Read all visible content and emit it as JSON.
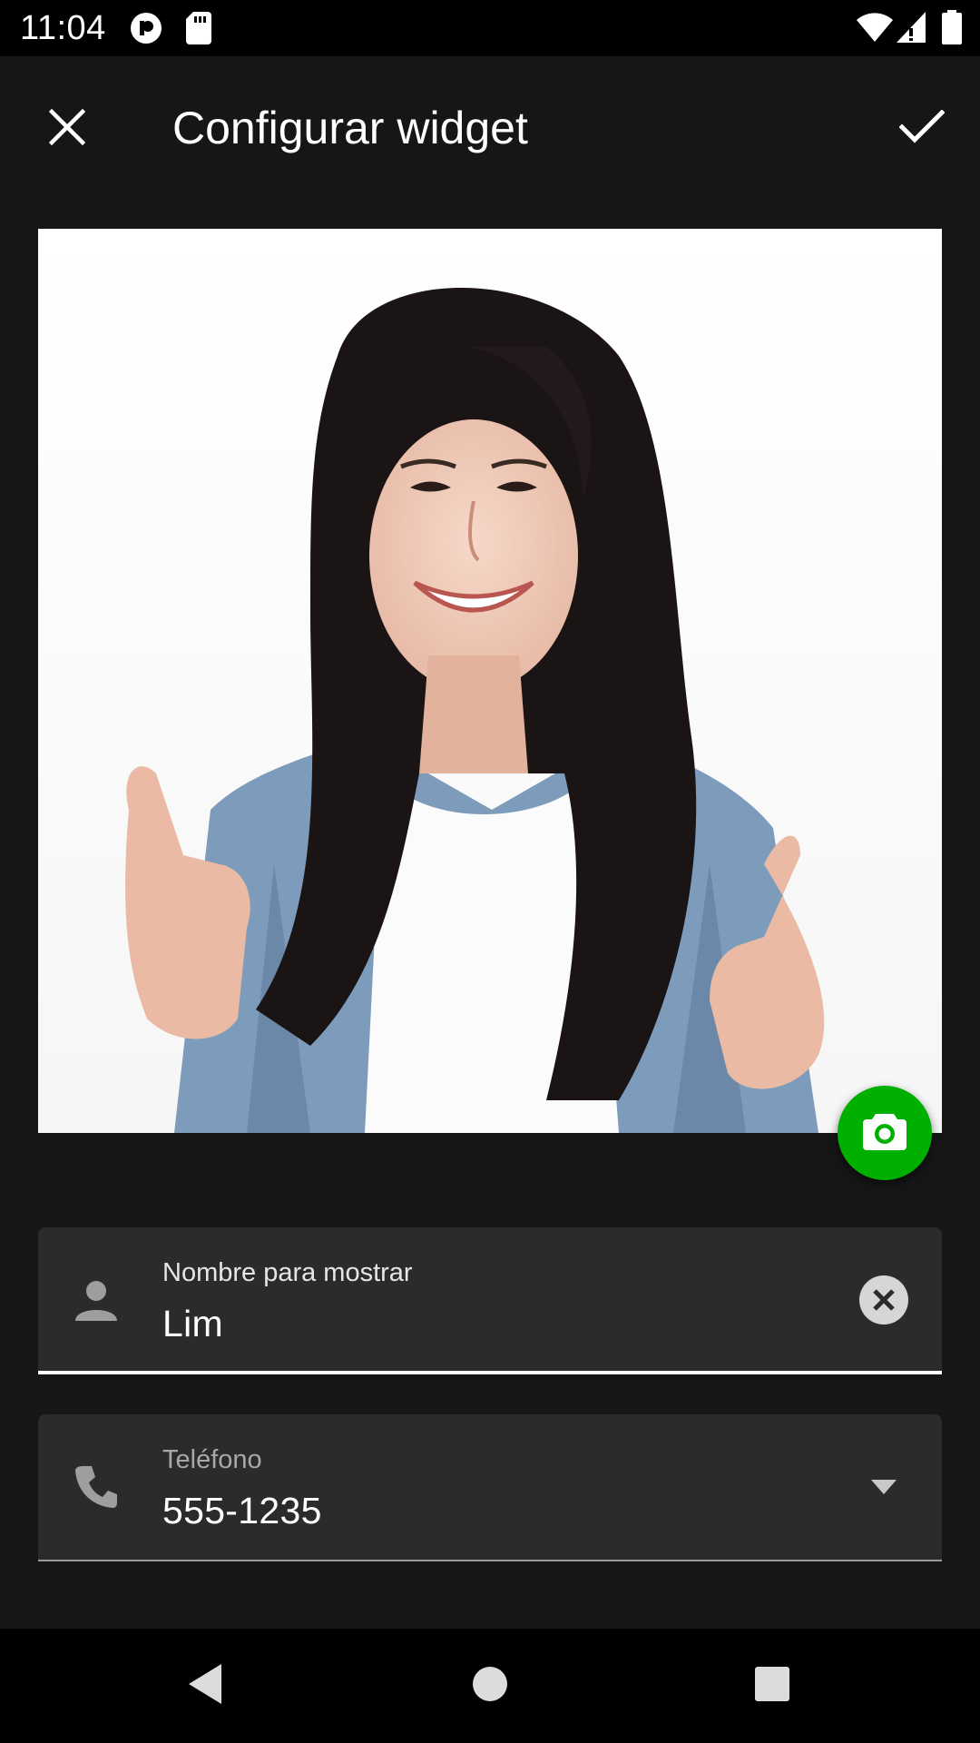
{
  "status_bar": {
    "time": "11:04",
    "icons": [
      "pocketcasts-notification-icon",
      "sd-card-icon",
      "wifi-icon",
      "signal-icon",
      "battery-icon"
    ]
  },
  "app_bar": {
    "title": "Configurar widget",
    "close_icon": "close-icon",
    "confirm_icon": "check-icon"
  },
  "photo": {
    "description_icon": "contact-photo",
    "fab_icon": "camera-icon",
    "fab_color": "#00b000"
  },
  "fields": {
    "name": {
      "label": "Nombre para mostrar",
      "value": "Lim",
      "icon": "person-icon",
      "trailing_icon": "clear-icon"
    },
    "phone": {
      "label": "Teléfono",
      "value": "555-1235",
      "icon": "phone-icon",
      "trailing_icon": "dropdown-arrow-icon"
    }
  },
  "nav_bar": {
    "back_icon": "back-icon",
    "home_icon": "home-icon",
    "recents_icon": "recents-icon"
  }
}
